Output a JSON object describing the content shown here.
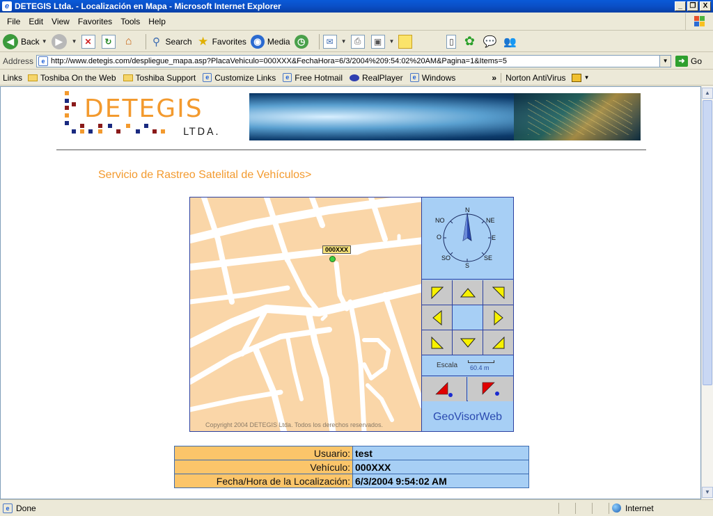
{
  "window": {
    "title": "DETEGIS Ltda. - Localización en Mapa - Microsoft Internet Explorer",
    "minimize": "_",
    "maximize": "❐",
    "close": "X"
  },
  "menu": [
    "File",
    "Edit",
    "View",
    "Favorites",
    "Tools",
    "Help"
  ],
  "toolbar": {
    "back": "Back",
    "search": "Search",
    "favorites": "Favorites",
    "media": "Media"
  },
  "address": {
    "label": "Address",
    "url": "http://www.detegis.com/despliegue_mapa.asp?PlacaVehiculo=000XXX&FechaHora=6/3/2004%209:54:02%20AM&Pagina=1&Items=5",
    "go": "Go"
  },
  "links": {
    "label": "Links",
    "items": [
      "Toshiba On the Web",
      "Toshiba Support",
      "Customize Links",
      "Free Hotmail",
      "RealPlayer",
      "Windows"
    ],
    "norton": "Norton AntiVirus"
  },
  "page": {
    "logo_brand": "DETEGIS",
    "logo_sub": "LTDA.",
    "heading": "Servicio de Rastreo Satelital de Vehículos>",
    "map": {
      "plate": "000XXX",
      "copyright": "Copyright 2004 DETEGIS Ltda. Todos los derechos reservados."
    },
    "compass": {
      "n": "N",
      "ne": "NE",
      "e": "E",
      "se": "SE",
      "s": "S",
      "so": "SO",
      "o": "O",
      "no": "NO"
    },
    "scale": {
      "label": "Escala",
      "value": "60.4 m"
    },
    "geovisor": "GeoVisorWeb",
    "info": [
      {
        "label": "Usuario:",
        "value": "test"
      },
      {
        "label": "Vehículo:",
        "value": "000XXX"
      },
      {
        "label": "Fecha/Hora de la Localización:",
        "value": "6/3/2004 9:54:02 AM"
      }
    ]
  },
  "status": {
    "text": "Done",
    "zone": "Internet"
  },
  "colors": {
    "accent_orange": "#f39a2e",
    "panel_blue": "#a7cff5",
    "map_bg": "#fad6a8",
    "label_bg": "#fbc56a",
    "arrow_yellow": "#f7f100",
    "zoom_red": "#e00000"
  },
  "icons": [
    "ie-page-icon",
    "back-icon",
    "forward-icon",
    "stop-icon",
    "refresh-icon",
    "home-icon",
    "search-icon",
    "favorites-star-icon",
    "media-icon",
    "history-icon",
    "mail-icon",
    "print-icon",
    "edit-icon",
    "discuss-icon",
    "folder-icon",
    "globe-icon"
  ]
}
